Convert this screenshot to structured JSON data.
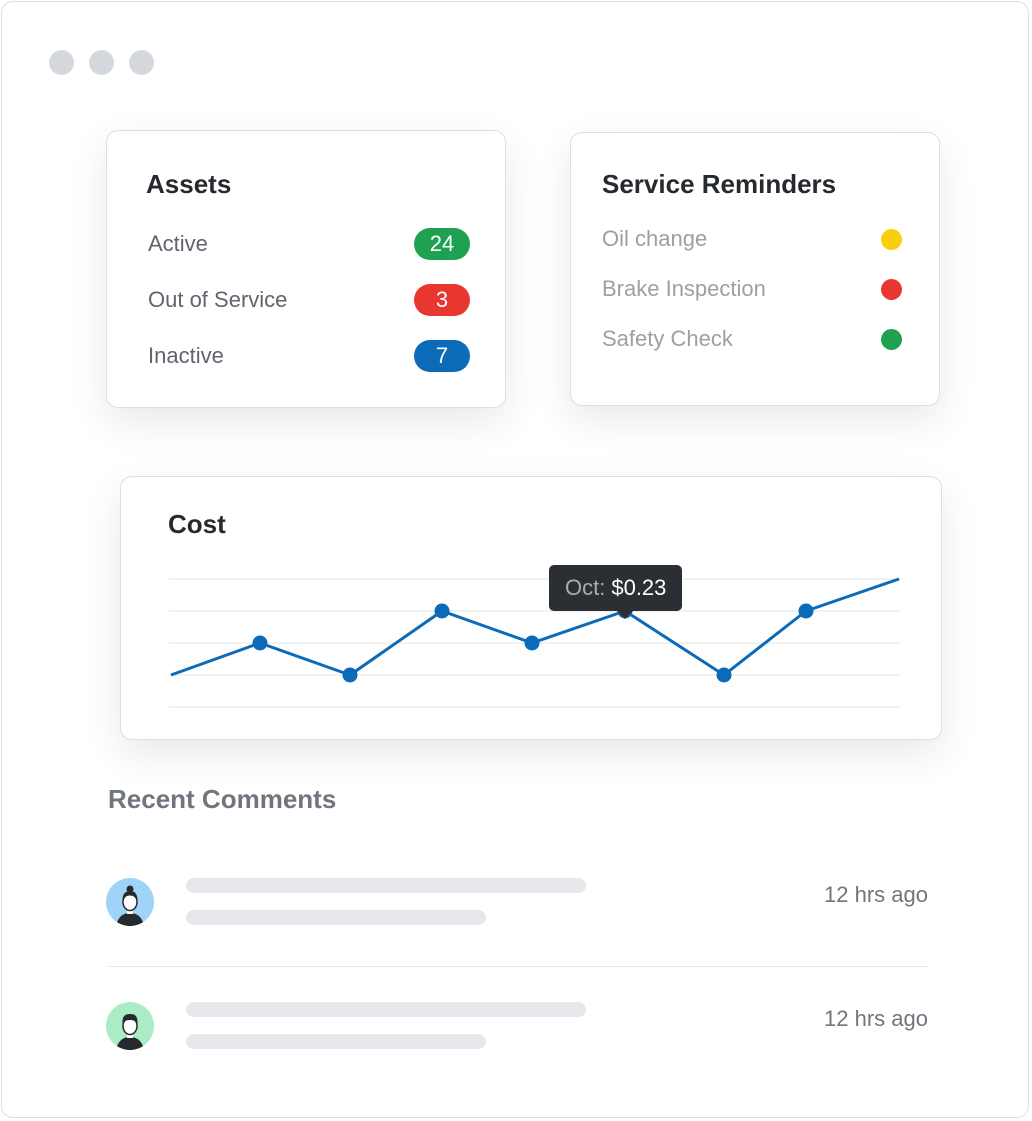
{
  "assets": {
    "title": "Assets",
    "rows": [
      {
        "label": "Active",
        "count": "24",
        "color": "#1fa152"
      },
      {
        "label": "Out of Service",
        "count": "3",
        "color": "#e8372e"
      },
      {
        "label": "Inactive",
        "count": "7",
        "color": "#0b6bb8"
      }
    ]
  },
  "reminders": {
    "title": "Service Reminders",
    "items": [
      {
        "label": "Oil change",
        "color": "#fbcd0c"
      },
      {
        "label": "Brake Inspection",
        "color": "#e8372e"
      },
      {
        "label": "Safety Check",
        "color": "#1fa152"
      }
    ]
  },
  "cost": {
    "title": "Cost",
    "tooltip": {
      "key": "Oct:",
      "value": "$0.23"
    },
    "line_color": "#0b6bb8"
  },
  "chart_data": {
    "type": "line",
    "title": "Cost",
    "x": [
      "",
      "",
      "",
      "",
      "",
      "Oct",
      "",
      "",
      ""
    ],
    "values": [
      0.17,
      0.2,
      0.17,
      0.23,
      0.2,
      0.23,
      0.17,
      0.23,
      0.26
    ],
    "markers_shown": [
      false,
      true,
      true,
      true,
      true,
      true,
      true,
      true,
      false
    ],
    "ylim": [
      0.14,
      0.26
    ],
    "grid": true
  },
  "comments": {
    "title": "Recent Comments",
    "items": [
      {
        "time": "12 hrs ago",
        "avatar": "woman-avatar-icon",
        "bg": "#9fd3f7"
      },
      {
        "time": "12 hrs ago",
        "avatar": "man-avatar-icon",
        "bg": "#a9ecc5"
      }
    ]
  }
}
